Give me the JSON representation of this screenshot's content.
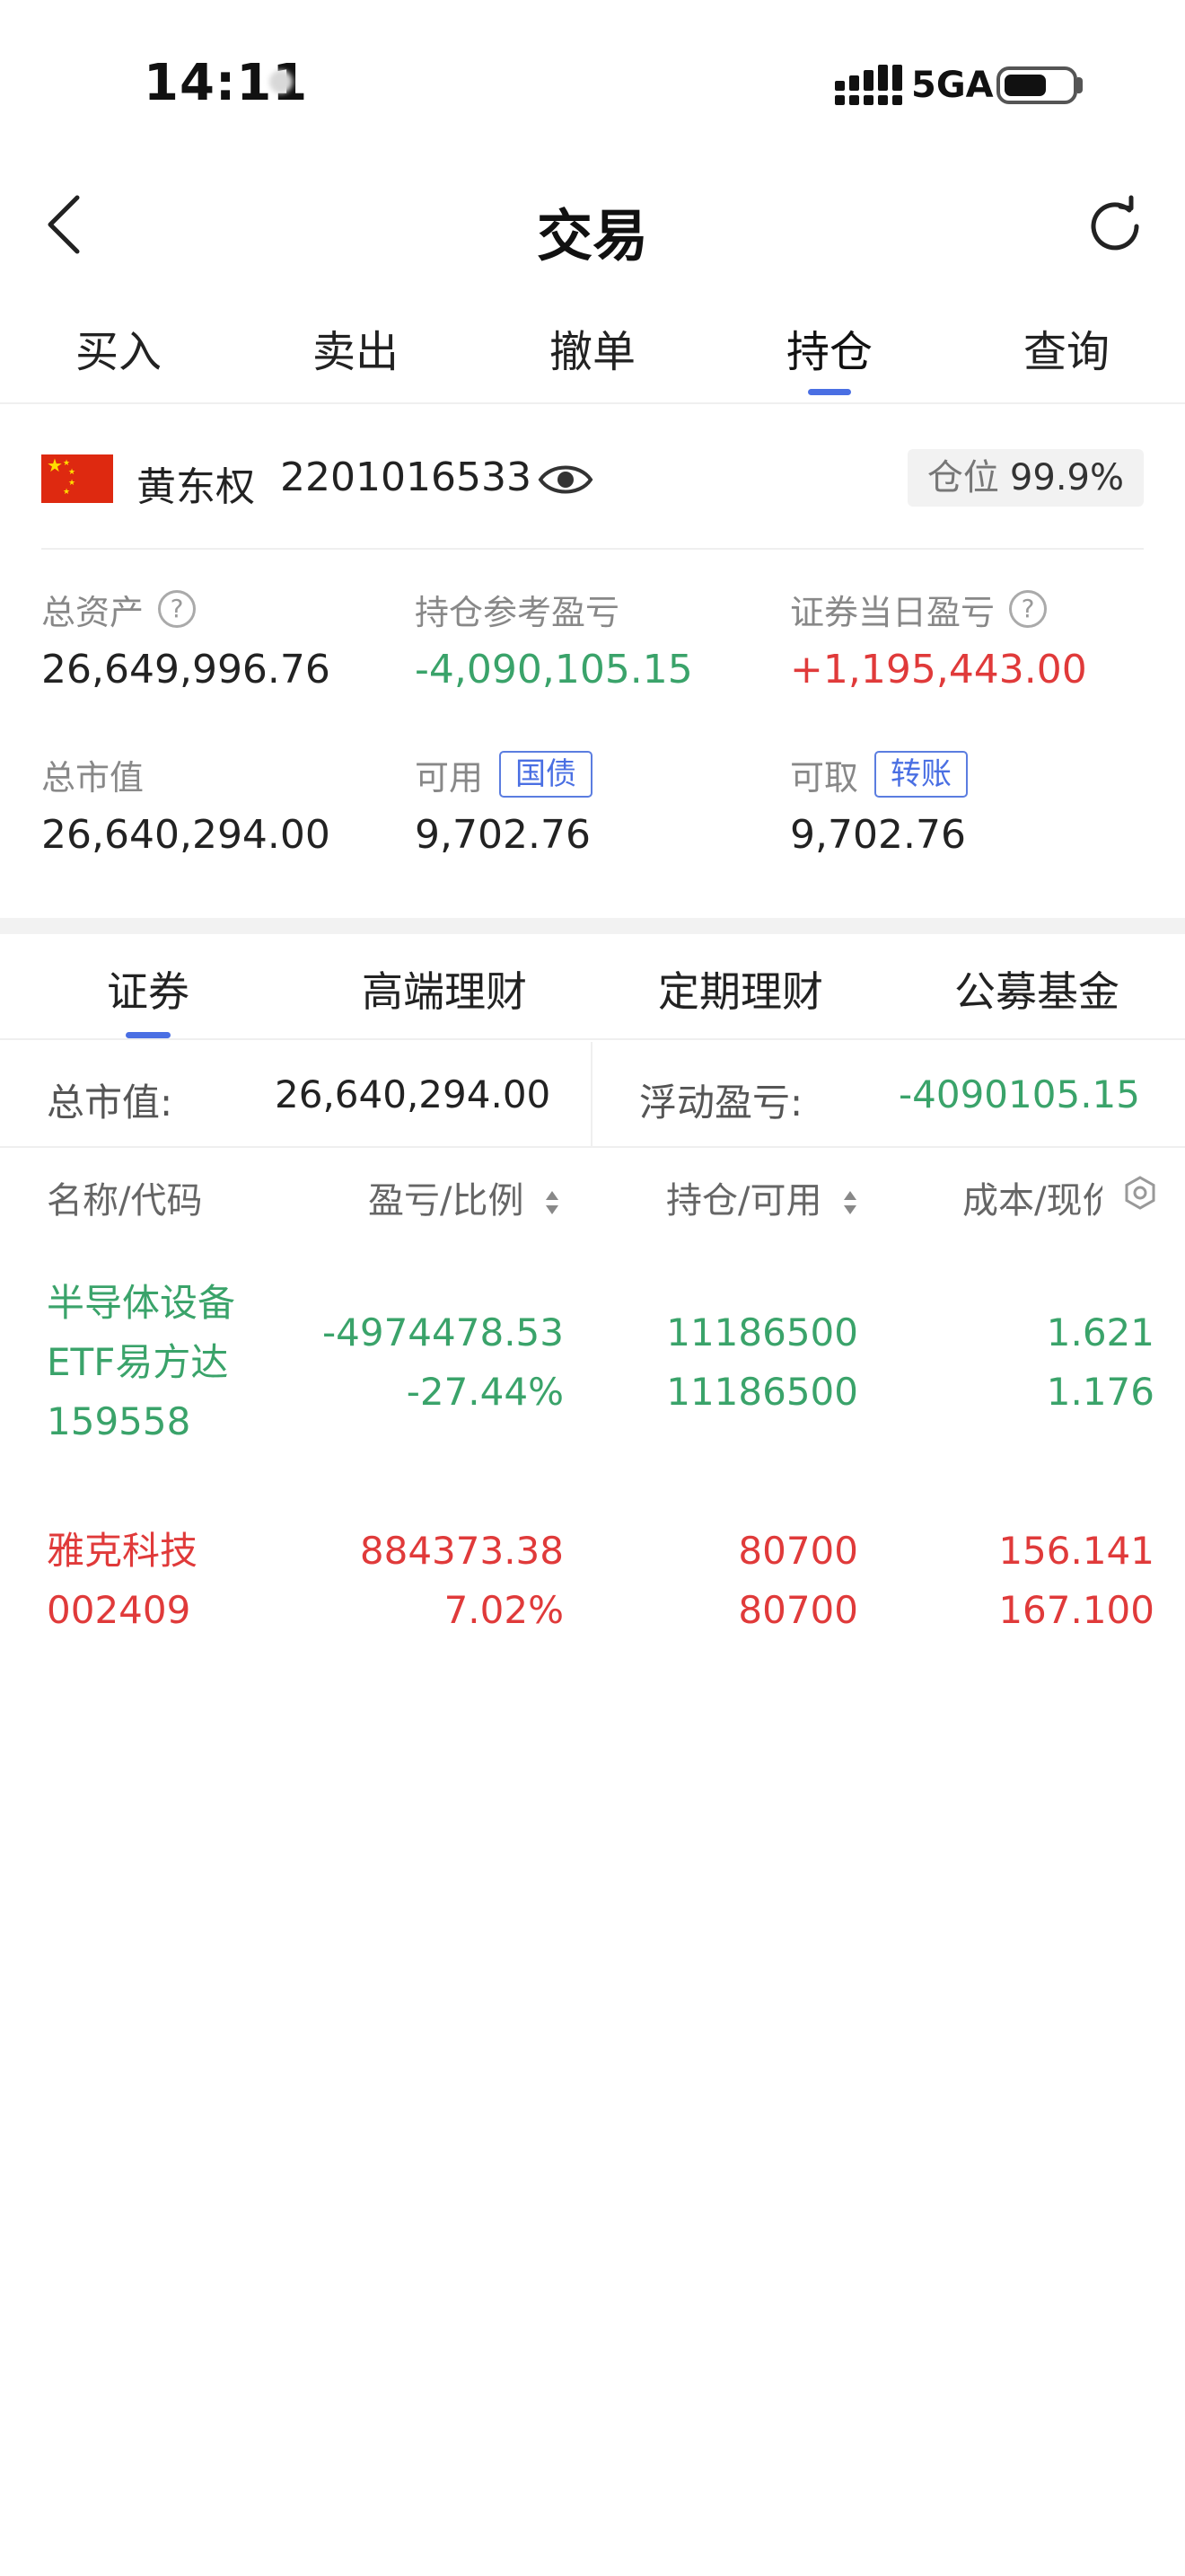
{
  "status_bar": {
    "time": "14:11",
    "network": "5GA"
  },
  "navbar": {
    "title": "交易"
  },
  "top_tabs": [
    {
      "label": "买入",
      "active": false
    },
    {
      "label": "卖出",
      "active": false
    },
    {
      "label": "撤单",
      "active": false
    },
    {
      "label": "持仓",
      "active": true
    },
    {
      "label": "查询",
      "active": false
    }
  ],
  "account": {
    "name": "黄东权",
    "number": "2201016533",
    "position_label": "仓位",
    "position_value": "99.9%"
  },
  "summary": {
    "total_assets": {
      "label": "总资产",
      "value": "26,649,996.76"
    },
    "holding_pnl": {
      "label": "持仓参考盈亏",
      "value": "-4,090,105.15"
    },
    "daily_pnl": {
      "label": "证券当日盈亏",
      "value": "+1,195,443.00"
    },
    "market_value": {
      "label": "总市值",
      "value": "26,640,294.00"
    },
    "available": {
      "label": "可用",
      "tag": "国债",
      "value": "9,702.76"
    },
    "withdrawable": {
      "label": "可取",
      "tag": "转账",
      "value": "9,702.76"
    }
  },
  "sub_tabs": [
    {
      "label": "证券",
      "active": true
    },
    {
      "label": "高端理财",
      "active": false
    },
    {
      "label": "定期理财",
      "active": false
    },
    {
      "label": "公募基金",
      "active": false
    }
  ],
  "totals": {
    "market_label": "总市值:",
    "market_value": "26,640,294.00",
    "float_label": "浮动盈亏:",
    "float_value": "-4090105.15"
  },
  "table": {
    "headers": {
      "name": "名称/代码",
      "pnl": "盈亏/比例",
      "holding": "持仓/可用",
      "cost": "成本/现价"
    },
    "rows": [
      {
        "name_line1": "半导体设备",
        "name_line2": "ETF易方达",
        "code": "159558",
        "pnl": "-4974478.53",
        "ratio": "-27.44%",
        "holding": "11186500",
        "available": "11186500",
        "cost": "1.621",
        "price": "1.176",
        "color": "#3aa36a"
      },
      {
        "name_line1": "雅克科技",
        "code": "002409",
        "pnl": "884373.38",
        "ratio": "7.02%",
        "holding": "80700",
        "available": "80700",
        "cost": "156.141",
        "price": "167.100",
        "color": "#e03a3a"
      }
    ]
  },
  "colors": {
    "accent": "#4a6fe3",
    "profit": "#e03a3a",
    "loss": "#3aa36a"
  }
}
